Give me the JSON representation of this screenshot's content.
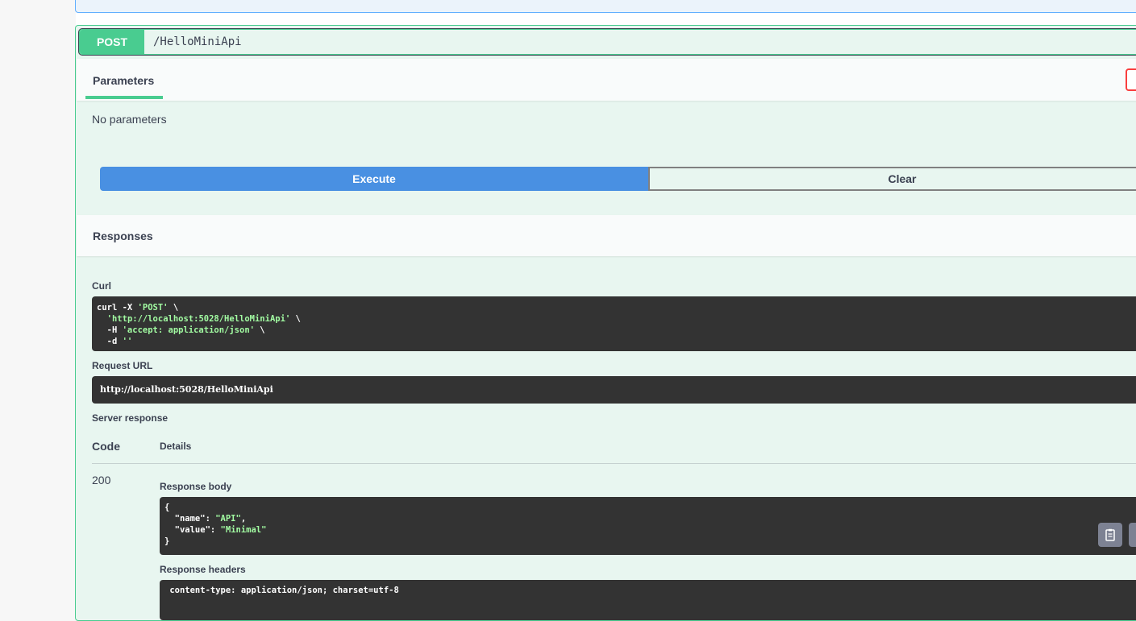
{
  "operation": {
    "method": "POST",
    "path": "/HelloMiniApi"
  },
  "parameters": {
    "tab_label": "Parameters",
    "empty_text": "No parameters"
  },
  "actions": {
    "execute_label": "Execute",
    "clear_label": "Clear"
  },
  "responses": {
    "header_label": "Responses",
    "curl_label": "Curl",
    "curl_lines": [
      [
        "curl -X ",
        "'POST'",
        " \\"
      ],
      [
        "  ",
        "'http://localhost:5028/HelloMiniApi'",
        " \\"
      ],
      [
        "  -H ",
        "'accept: application/json'",
        " \\"
      ],
      [
        "  -d ",
        "''",
        ""
      ]
    ],
    "request_url_label": "Request URL",
    "request_url": "http://localhost:5028/HelloMiniApi",
    "server_response_label": "Server response",
    "code_col": "Code",
    "details_col": "Details",
    "status_code": "200",
    "response_body_label": "Response body",
    "response_body_lines": [
      [
        "{",
        "",
        ""
      ],
      [
        "  \"name\": ",
        "\"API\"",
        ","
      ],
      [
        "  \"value\": ",
        "\"Minimal\"",
        ""
      ],
      [
        "}",
        "",
        ""
      ]
    ],
    "response_headers_label": "Response headers",
    "response_headers_partial": " content-type: application/json; charset=utf-8"
  },
  "icons": {
    "copy": "clipboard-icon",
    "download": "download-icon"
  },
  "colors": {
    "post_green": "#49cc90",
    "execute_blue": "#4990e2",
    "code_bg": "#333333",
    "string_green": "#a2fca2",
    "try_out_red": "#f93e3e"
  }
}
